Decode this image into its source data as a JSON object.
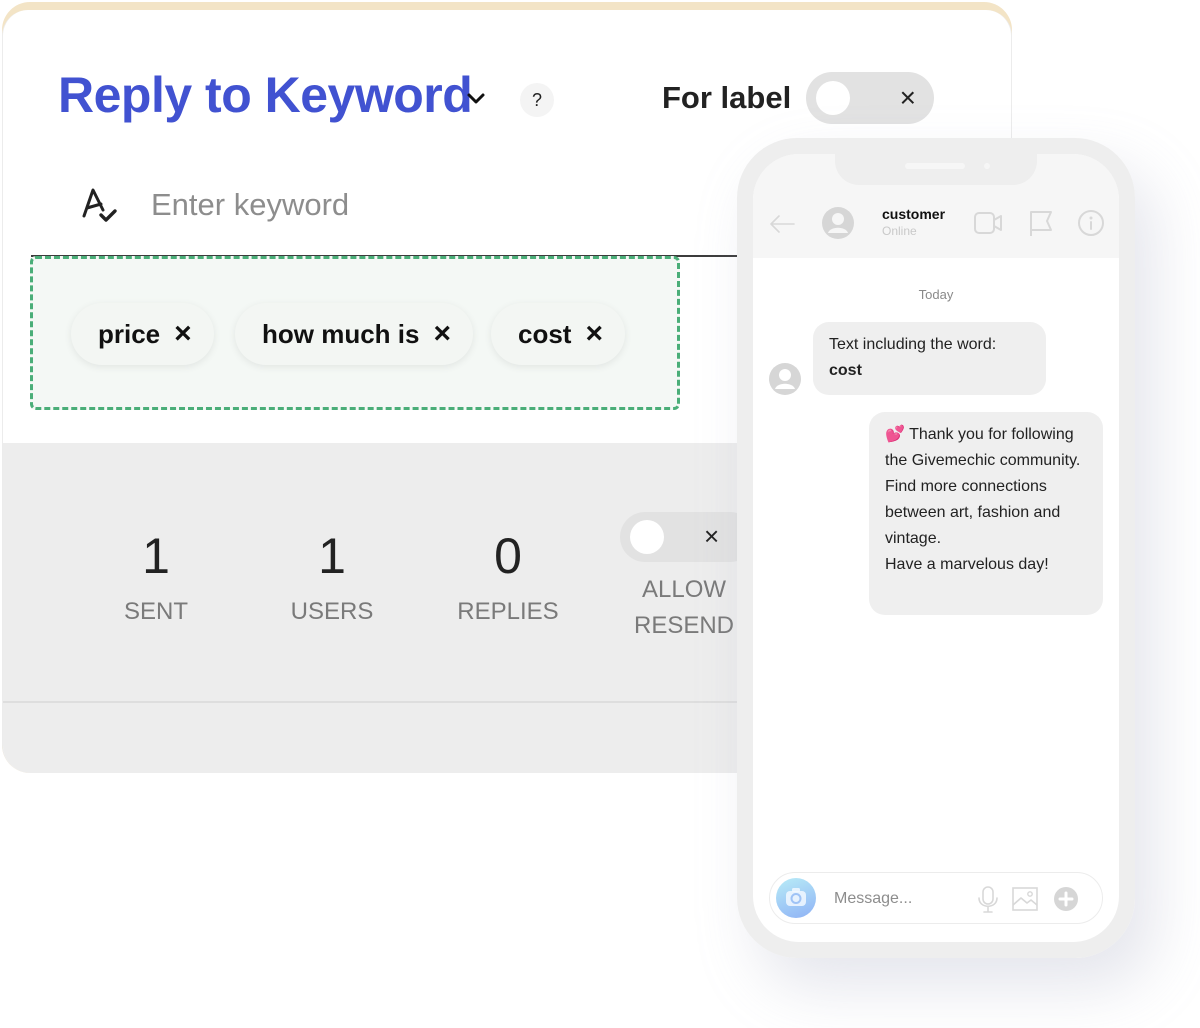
{
  "header": {
    "title": "Reply to Keyword",
    "help_label": "?",
    "for_label": "For label",
    "for_label_toggle": {
      "on": false,
      "off_glyph": "×"
    }
  },
  "keyword_input": {
    "placeholder": "Enter keyword",
    "value": "",
    "icon": "spellcheck-icon"
  },
  "keywords": [
    {
      "label": "price",
      "remove_glyph": "×"
    },
    {
      "label": "how much is",
      "remove_glyph": "×"
    },
    {
      "label": "cost",
      "remove_glyph": "×"
    }
  ],
  "colors": {
    "title": "#4152d1",
    "tag_border": "#4aae78",
    "top_accent": "#f3e4c6"
  },
  "stats": [
    {
      "value": "1",
      "label": "SENT"
    },
    {
      "value": "1",
      "label": "USERS"
    },
    {
      "value": "0",
      "label": "REPLIES"
    }
  ],
  "allow_resend": {
    "label_line1": "ALLOW",
    "label_line2": "RESEND",
    "on": false,
    "off_glyph": "×"
  },
  "phone": {
    "contact_name": "customer",
    "contact_status": "Online",
    "day_label": "Today",
    "incoming": {
      "text": "Text including the word:",
      "keyword": "cost"
    },
    "outgoing": {
      "lines": [
        "💕 Thank you for following the Givemechic community.",
        "Find more connections between art, fashion and vintage.",
        "Have a marvelous day!"
      ]
    },
    "message_placeholder": "Message..."
  }
}
